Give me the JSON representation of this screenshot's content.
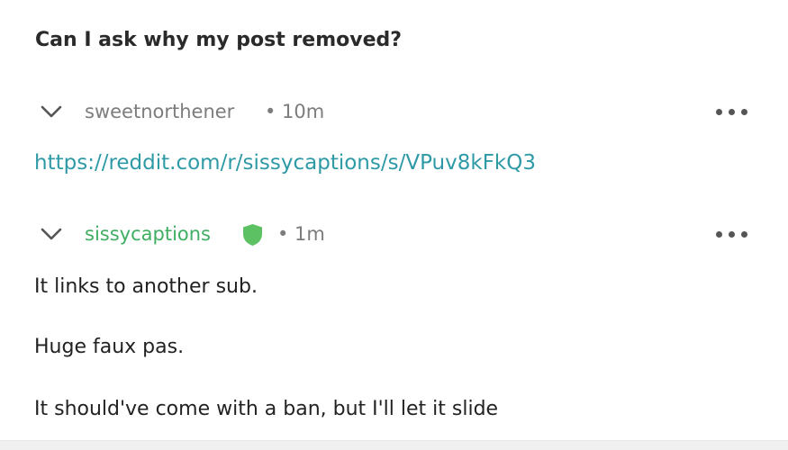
{
  "post": {
    "title": "Can I ask why my post removed?"
  },
  "comments": [
    {
      "author": "sweetnorthener",
      "meta": "• 10m",
      "link": "https://reddit.com/r/sissycaptions/s/VPuv8kFkQ3"
    },
    {
      "author": "sissycaptions",
      "meta": "• 1m",
      "badge_icon": "shield-icon",
      "body": [
        "It links to another sub.",
        "Huge faux pas.",
        "It should've come with a ban, but I'll let it slide"
      ]
    }
  ],
  "colors": {
    "mod_green": "#3fae63",
    "link_teal": "#2e9aa6",
    "meta_gray": "#7c7c7c"
  }
}
